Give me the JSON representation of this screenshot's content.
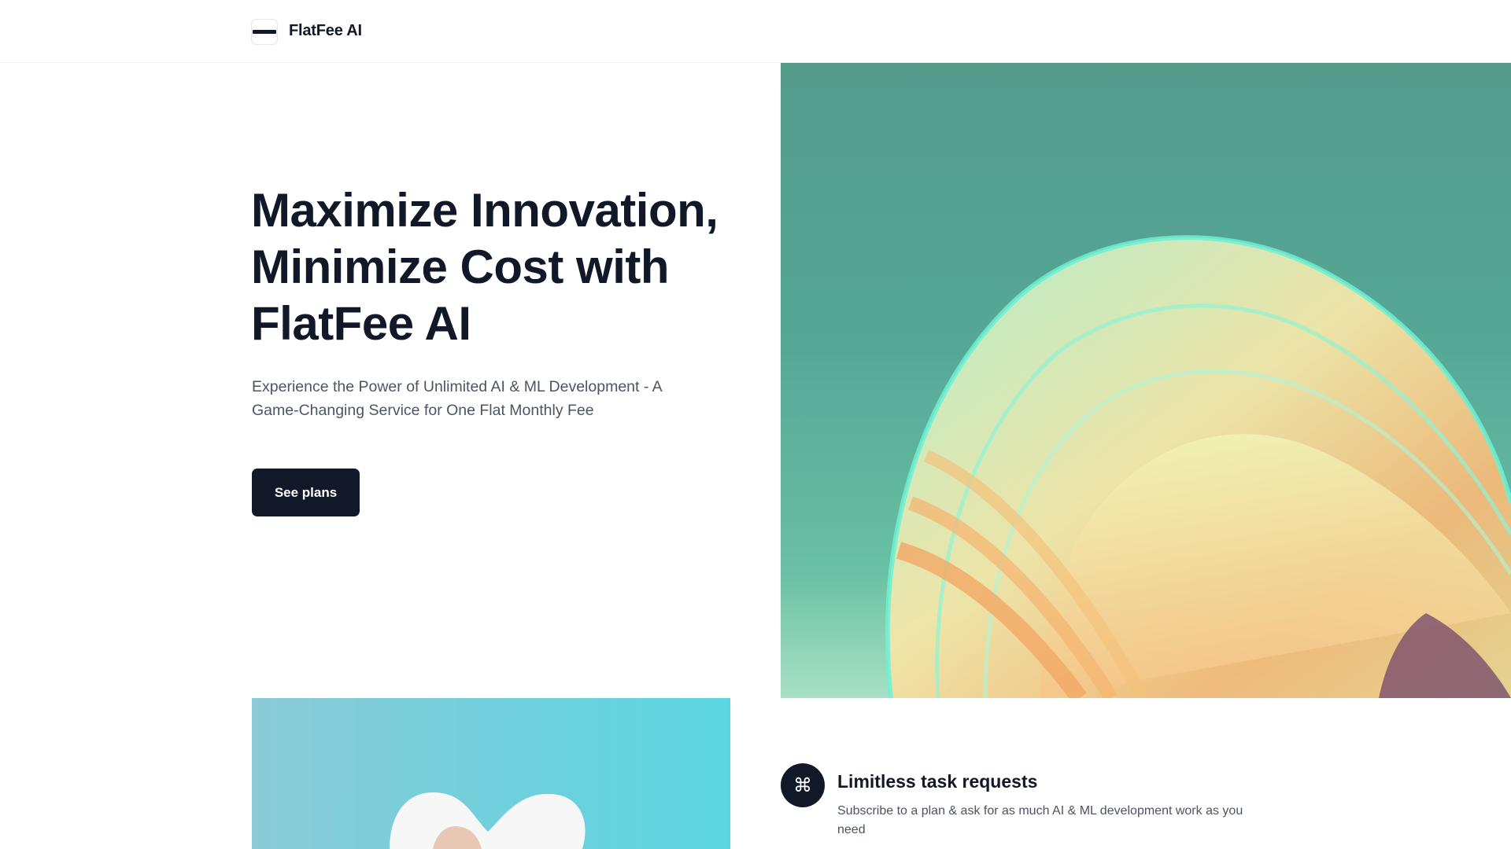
{
  "header": {
    "brand": "FlatFee AI",
    "logo_icon": "menu-bar-icon"
  },
  "hero": {
    "title": "Maximize Innovation, Minimize Cost with FlatFee AI",
    "subtitle": "Experience the Power of Unlimited AI & ML Development - A Game-Changing Service for One Flat Monthly Fee",
    "cta_label": "See plans"
  },
  "feature": {
    "icon": "command-icon",
    "icon_glyph": "⌘",
    "title": "Limitless task requests",
    "description": "Subscribe to a plan & ask for as much AI & ML development work as you need"
  },
  "colors": {
    "primary": "#111827",
    "text_muted": "#4b5563",
    "hero_image_bg": "#55a896",
    "bottom_image_bg": "#6fd0dc"
  }
}
